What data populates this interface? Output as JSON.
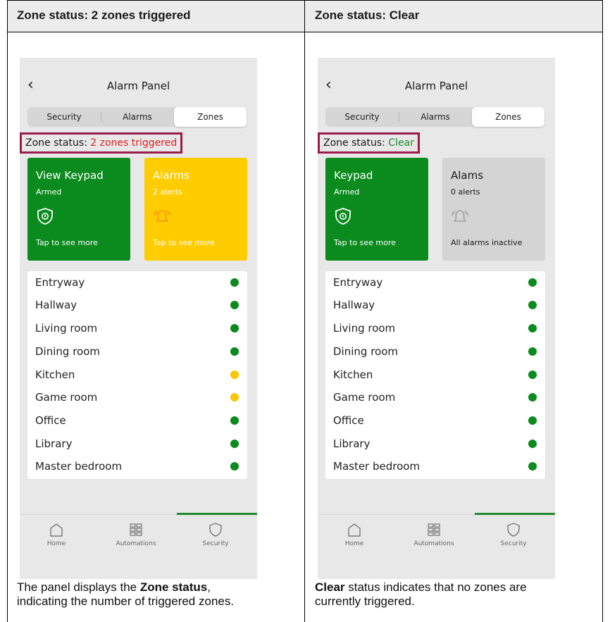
{
  "columns": [
    {
      "title": "Zone status: 2 zones triggered",
      "caption": {
        "part1": "The panel displays the ",
        "bold": "Zone status",
        "part2": ",\nindicating the number of triggered zones."
      },
      "phone": {
        "back_icon": "‹",
        "title": "Alarm Panel",
        "segments": [
          "Security",
          "Alarms",
          "Zones"
        ],
        "selected_segment": "Zones",
        "zone_status_label": "Zone status: ",
        "zone_status_value": "2 zones triggered",
        "zone_status_color": "#e02020",
        "cards": [
          {
            "title": "View Keypad",
            "sub": "Armed",
            "foot": "Tap to see more",
            "bg": "#0b8a1e",
            "icon": "shield-lock-icon"
          },
          {
            "title": "Alarms",
            "sub": "2 alerts",
            "foot": "Tap to see more",
            "bg": "#ffcc00",
            "icon": "bell-ringing-icon"
          }
        ],
        "zones": [
          {
            "name": "Entryway",
            "status": "ok"
          },
          {
            "name": "Hallway",
            "status": "ok"
          },
          {
            "name": "Living room",
            "status": "ok"
          },
          {
            "name": "Dining room",
            "status": "ok"
          },
          {
            "name": "Kitchen",
            "status": "triggered"
          },
          {
            "name": "Game room",
            "status": "triggered"
          },
          {
            "name": "Office",
            "status": "ok"
          },
          {
            "name": "Library",
            "status": "ok"
          },
          {
            "name": "Master bedroom",
            "status": "ok"
          }
        ],
        "tabs": [
          {
            "label": "Home",
            "icon": "home-icon"
          },
          {
            "label": "Automations",
            "icon": "grid-icon"
          },
          {
            "label": "Security",
            "icon": "shield-icon",
            "active": true
          }
        ]
      }
    },
    {
      "title": "Zone status: Clear",
      "caption": {
        "bold": "Clear",
        "part2": " status indicates that no zones are\ncurrently triggered."
      },
      "phone": {
        "back_icon": "‹",
        "title": "Alarm Panel",
        "segments": [
          "Security",
          "Alarms",
          "Zones"
        ],
        "selected_segment": "Zones",
        "zone_status_label": "Zone status: ",
        "zone_status_value": "Clear",
        "zone_status_color": "#1e8a2c",
        "cards": [
          {
            "title": "Keypad",
            "sub": "Armed",
            "foot": "Tap to see more",
            "bg": "#0b8a1e",
            "icon": "shield-lock-icon"
          },
          {
            "title": "Alams",
            "sub": "0 alerts",
            "foot": "All alarms inactive",
            "bg": "#d4d4d4",
            "icon": "bell-ringing-icon"
          }
        ],
        "zones": [
          {
            "name": "Entryway",
            "status": "ok"
          },
          {
            "name": "Hallway",
            "status": "ok"
          },
          {
            "name": "Living room",
            "status": "ok"
          },
          {
            "name": "Dining room",
            "status": "ok"
          },
          {
            "name": "Kitchen",
            "status": "ok"
          },
          {
            "name": "Game room",
            "status": "ok"
          },
          {
            "name": "Office",
            "status": "ok"
          },
          {
            "name": "Library",
            "status": "ok"
          },
          {
            "name": "Master bedroom",
            "status": "ok"
          }
        ],
        "tabs": [
          {
            "label": "Home",
            "icon": "home-icon"
          },
          {
            "label": "Automations",
            "icon": "grid-icon"
          },
          {
            "label": "Security",
            "icon": "shield-icon",
            "active": true
          }
        ]
      }
    }
  ],
  "colors": {
    "ok": "#0b8a1e",
    "triggered": "#ffc400",
    "highlight_border": "#9b1b4a",
    "active_tab": "#1e8a2c"
  }
}
